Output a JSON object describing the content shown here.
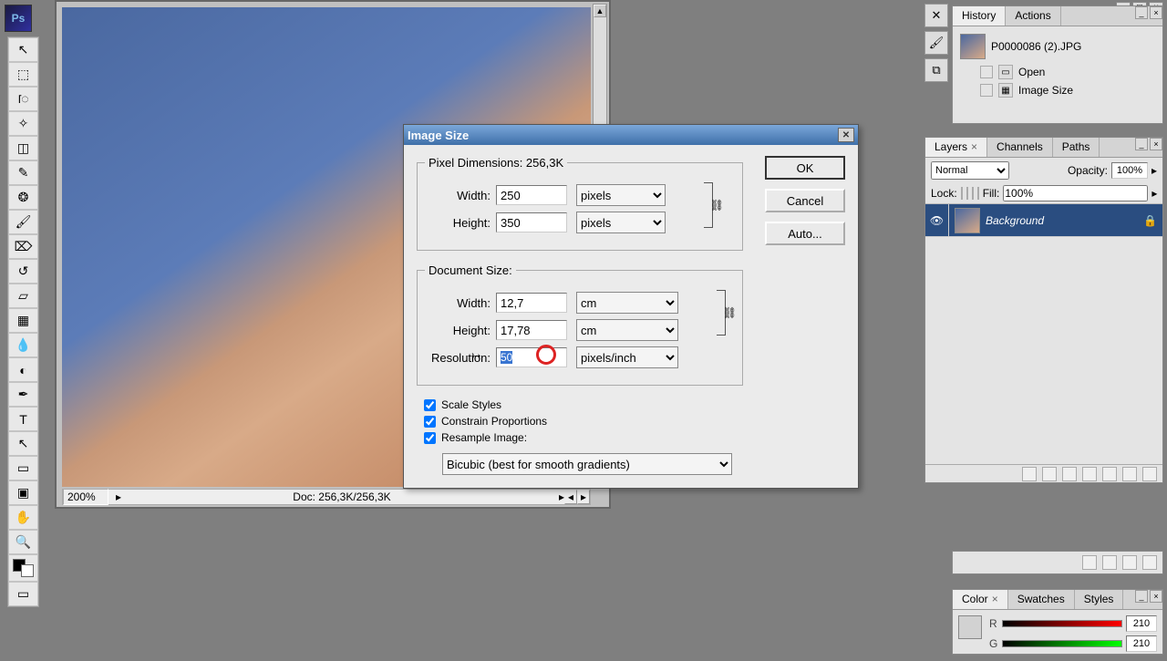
{
  "app": {
    "logo_text": "Ps"
  },
  "toolbox": {
    "tools": [
      "↖",
      "⬚",
      "ॎ",
      "✂",
      "◫",
      "✎",
      "⌁",
      "⧉",
      "✥",
      "◔",
      "▤",
      "◑",
      "◐",
      "△",
      "⊿",
      "✒",
      "T",
      "↗",
      "☊"
    ]
  },
  "document": {
    "zoom": "200%",
    "info": "Doc: 256,3K/256,3K"
  },
  "dialog": {
    "title": "Image Size",
    "pixel_legend": "Pixel Dimensions:  256,3K",
    "px_width_label": "Width:",
    "px_width_value": "250",
    "px_width_unit": "pixels",
    "px_height_label": "Height:",
    "px_height_value": "350",
    "px_height_unit": "pixels",
    "doc_legend": "Document Size:",
    "doc_width_label": "Width:",
    "doc_width_value": "12,7",
    "doc_width_unit": "cm",
    "doc_height_label": "Height:",
    "doc_height_value": "17,78",
    "doc_height_unit": "cm",
    "res_label": "Resolution:",
    "res_value": "50",
    "res_unit": "pixels/inch",
    "scale_styles": "Scale Styles",
    "constrain": "Constrain Proportions",
    "resample": "Resample Image:",
    "resample_method": "Bicubic (best for smooth gradients)",
    "btn_ok": "OK",
    "btn_cancel": "Cancel",
    "btn_auto": "Auto..."
  },
  "history": {
    "tab_history": "History",
    "tab_actions": "Actions",
    "doc_name": "P0000086 (2).JPG",
    "steps": [
      {
        "label": "Open"
      },
      {
        "label": "Image Size"
      }
    ]
  },
  "layers": {
    "tab_layers": "Layers",
    "tab_channels": "Channels",
    "tab_paths": "Paths",
    "blend_mode": "Normal",
    "opacity_label": "Opacity:",
    "opacity_value": "100%",
    "lock_label": "Lock:",
    "fill_label": "Fill:",
    "fill_value": "100%",
    "items": [
      {
        "name": "Background"
      }
    ]
  },
  "color": {
    "tab_color": "Color",
    "tab_swatches": "Swatches",
    "tab_styles": "Styles",
    "r_label": "R",
    "r_value": "210",
    "g_label": "G",
    "g_value": "210"
  }
}
